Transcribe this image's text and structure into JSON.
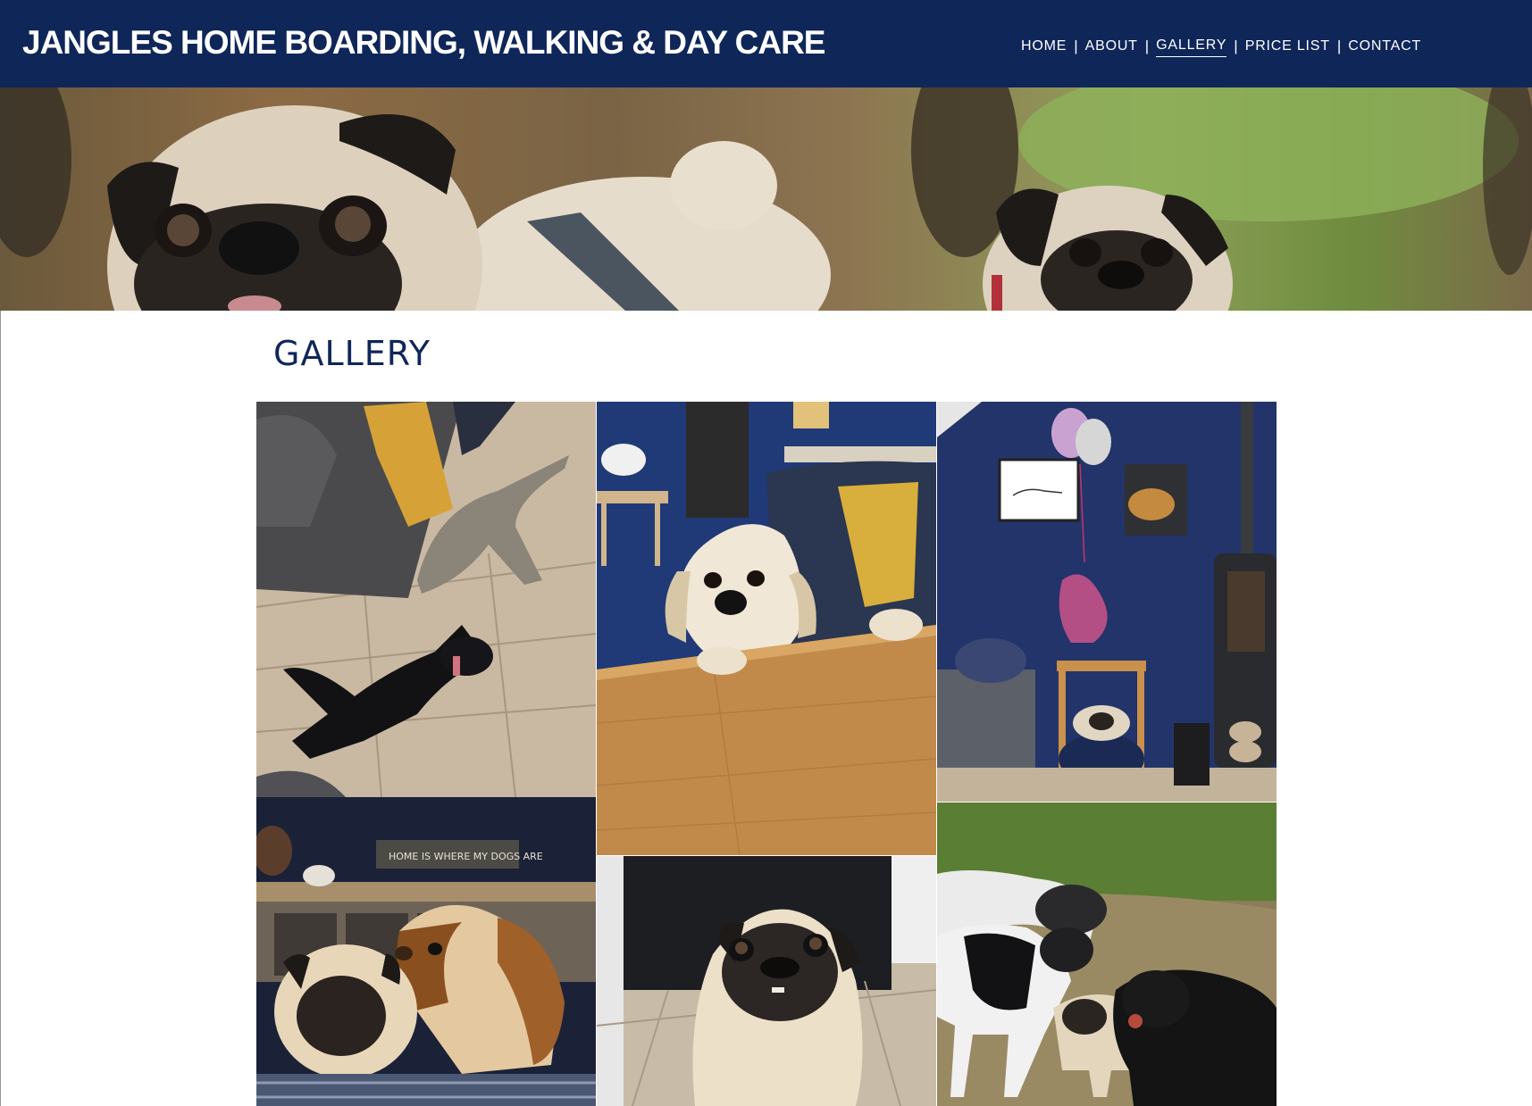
{
  "site": {
    "title": "JANGLES HOME BOARDING, WALKING & DAY CARE"
  },
  "nav": {
    "items": [
      {
        "label": "HOME"
      },
      {
        "label": "ABOUT"
      },
      {
        "label": "GALLERY",
        "active": true
      },
      {
        "label": "PRICE LIST"
      },
      {
        "label": "CONTACT"
      }
    ],
    "separator": "|"
  },
  "page": {
    "heading": "GALLERY"
  },
  "gallery": {
    "photos": [
      {
        "subject": "dogs-on-floor"
      },
      {
        "subject": "beagle-at-table"
      },
      {
        "subject": "pug-in-bed-by-stove"
      },
      {
        "subject": "pug-and-basset-on-sofa",
        "sign_text": "HOME IS WHERE MY DOGS ARE"
      },
      {
        "subject": "pug-closeup"
      },
      {
        "subject": "dogs-in-field"
      }
    ]
  },
  "colors": {
    "header_bg": "#0f2659",
    "heading": "#0f2659",
    "nav_text": "#ffffff"
  }
}
